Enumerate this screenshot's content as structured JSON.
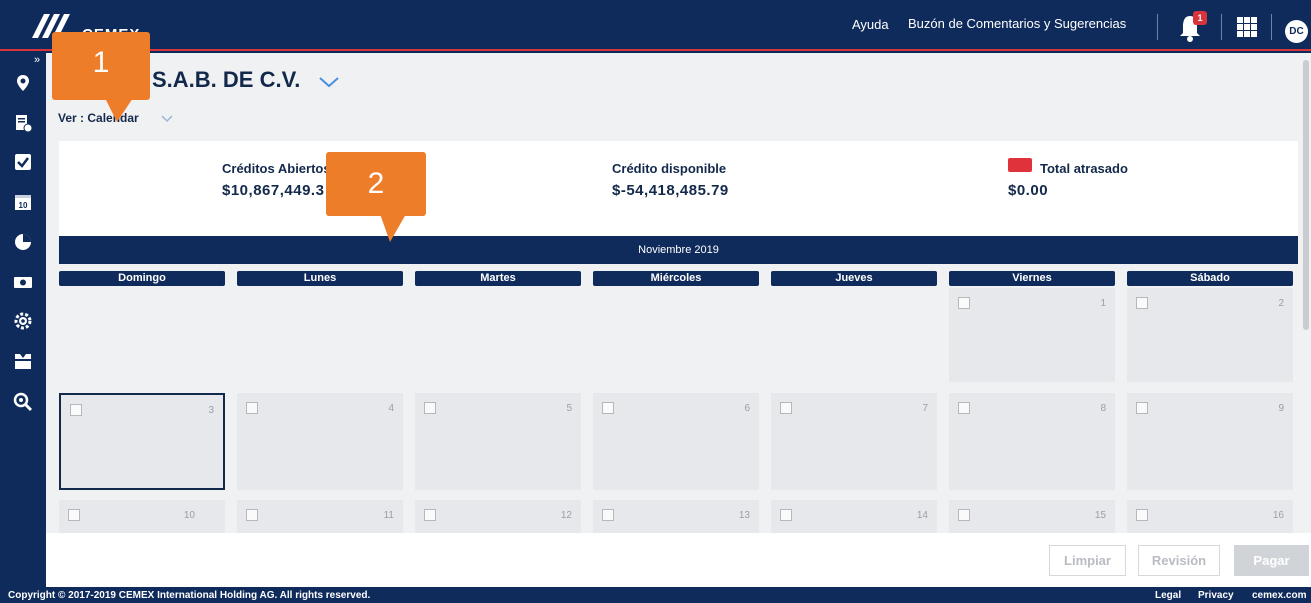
{
  "header": {
    "logo_text": "CEMEX",
    "help_label": "Ayuda",
    "feedback_label": "Buzón de Comentarios y Sugerencias",
    "notification_count": "1",
    "avatar_initials": "DC"
  },
  "sidebar": {
    "toggle": "»",
    "icons": [
      "location-pin-icon",
      "invoice-check-icon",
      "checkbox-icon",
      "calendar-icon",
      "chart-icon",
      "cash-icon",
      "gear-icon",
      "box-icon",
      "search-icon"
    ]
  },
  "page": {
    "company_title": "S.A.B. DE C.V.",
    "view_label": "Ver : Calendar"
  },
  "summary": {
    "open_credits_label": "Créditos Abiertos",
    "open_credits_value": "$10,867,449.3",
    "available_credit_label": "Crédito disponible",
    "available_credit_value": "$-54,418,485.79",
    "overdue_label": "Total atrasado",
    "overdue_value": "$0.00"
  },
  "calendar": {
    "month": "Noviembre 2019",
    "weekdays": [
      "Domingo",
      "Lunes",
      "Martes",
      "Miércoles",
      "Jueves",
      "Viernes",
      "Sábado"
    ],
    "days": [
      "1",
      "2",
      "3",
      "4",
      "5",
      "6",
      "7",
      "8",
      "9",
      "10",
      "11",
      "12",
      "13",
      "14",
      "15",
      "16"
    ],
    "selected_day": "3"
  },
  "actions": {
    "clear_label": "Limpiar",
    "review_label": "Revisión",
    "pay_label": "Pagar"
  },
  "footer": {
    "copyright": "Copyright © 2017-2019 CEMEX International Holding AG. All rights reserved.",
    "legal": "Legal",
    "privacy": "Privacy",
    "site": "cemex.com"
  },
  "callouts": [
    "1",
    "2"
  ],
  "colors": {
    "navy": "#0f2b5b",
    "accent_red": "#d9343b",
    "callout_orange": "#ee7d2a"
  }
}
